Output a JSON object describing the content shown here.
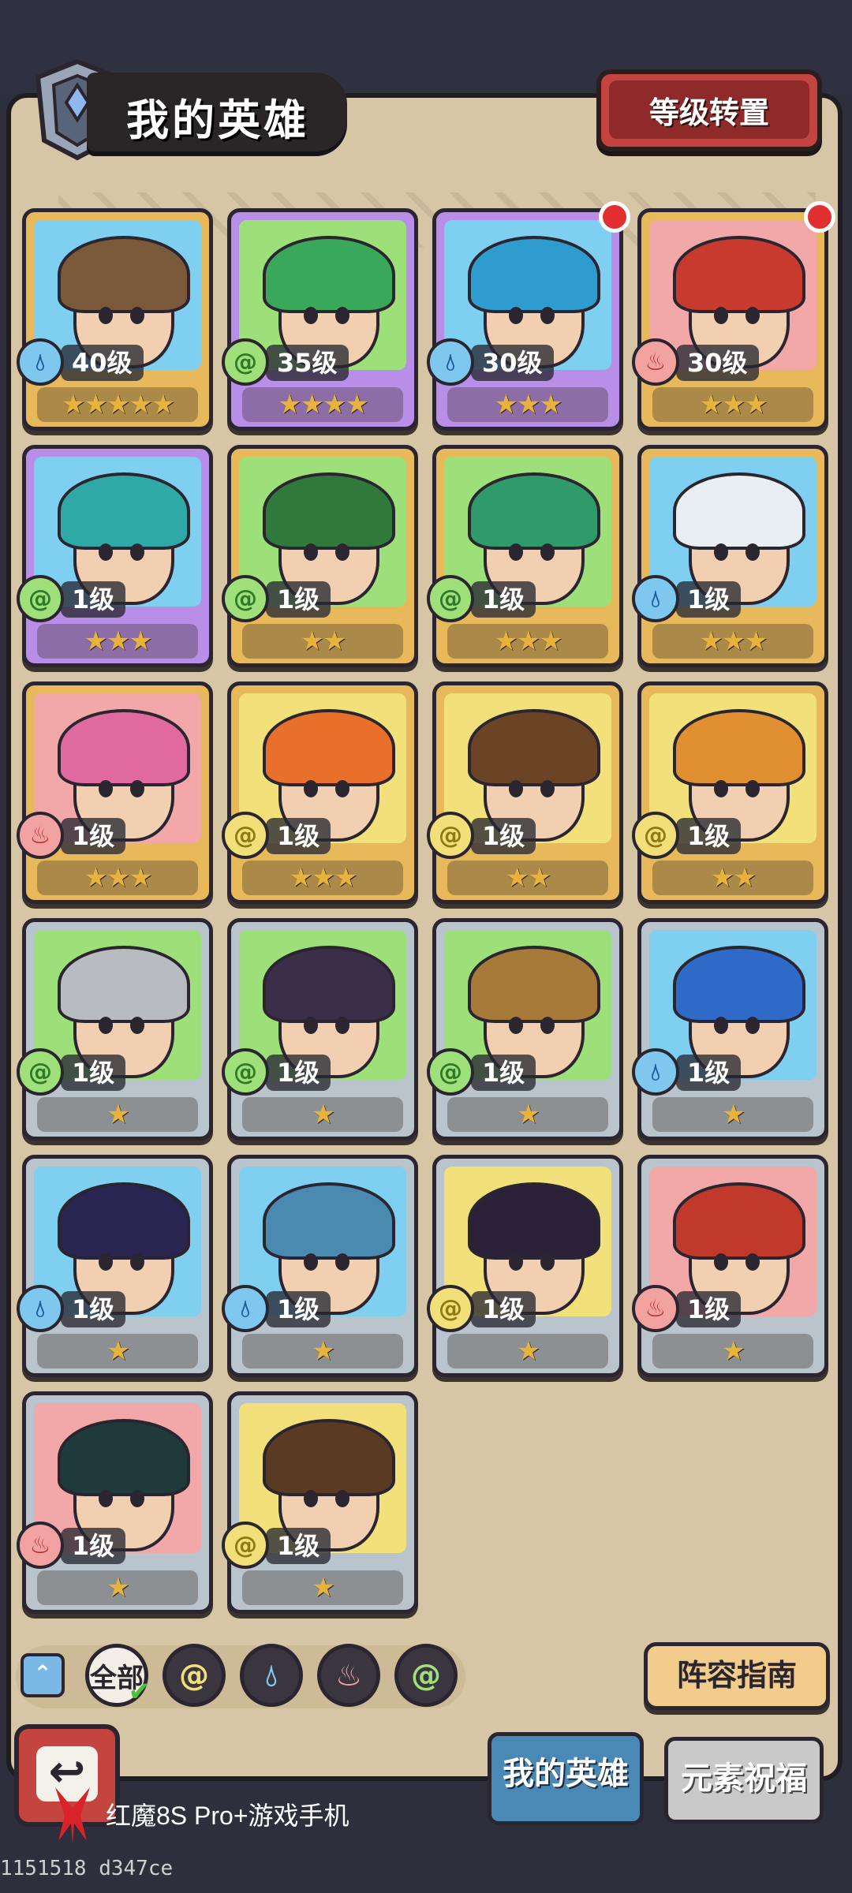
{
  "header": {
    "title": "我的英雄",
    "level_transfer_button": "等级转置"
  },
  "heroes": [
    {
      "level": "40级",
      "stars": "★★★★★",
      "element": "water",
      "rarity": "gold",
      "bg": "#7fd0f0",
      "hair": "#7a5a3a",
      "new": false
    },
    {
      "level": "35级",
      "stars": "★★★★",
      "element": "wind",
      "rarity": "purple",
      "bg": "#9de07a",
      "hair": "#3aa85a",
      "new": false
    },
    {
      "level": "30级",
      "stars": "★★★",
      "element": "water",
      "rarity": "purple",
      "bg": "#7fd0f0",
      "hair": "#2f9ccf",
      "new": true
    },
    {
      "level": "30级",
      "stars": "★★★",
      "element": "fire",
      "rarity": "gold",
      "bg": "#f2a8a8",
      "hair": "#c93a2e",
      "new": true
    },
    {
      "level": "1级",
      "stars": "★★★",
      "element": "wind",
      "rarity": "purple",
      "bg": "#7fd0f0",
      "hair": "#2fa8a8",
      "new": false
    },
    {
      "level": "1级",
      "stars": "★★",
      "element": "wind",
      "rarity": "gold",
      "bg": "#9de07a",
      "hair": "#2f7a3a",
      "new": false
    },
    {
      "level": "1级",
      "stars": "★★★",
      "element": "wind",
      "rarity": "gold",
      "bg": "#9de07a",
      "hair": "#2f9a6a",
      "new": false
    },
    {
      "level": "1级",
      "stars": "★★★",
      "element": "water",
      "rarity": "gold",
      "bg": "#7fd0f0",
      "hair": "#e8eef2",
      "new": false
    },
    {
      "level": "1级",
      "stars": "★★★",
      "element": "fire",
      "rarity": "gold",
      "bg": "#f2a8a8",
      "hair": "#e06aa0",
      "new": false
    },
    {
      "level": "1级",
      "stars": "★★★",
      "element": "earth",
      "rarity": "gold",
      "bg": "#f2e07a",
      "hair": "#e8702a",
      "new": false
    },
    {
      "level": "1级",
      "stars": "★★",
      "element": "earth",
      "rarity": "gold",
      "bg": "#f2e07a",
      "hair": "#6a4424",
      "new": false
    },
    {
      "level": "1级",
      "stars": "★★",
      "element": "earth",
      "rarity": "gold",
      "bg": "#f2e07a",
      "hair": "#e09030",
      "new": false
    },
    {
      "level": "1级",
      "stars": "★",
      "element": "wind",
      "rarity": "silver",
      "bg": "#9de07a",
      "hair": "#b8bcc0",
      "new": false
    },
    {
      "level": "1级",
      "stars": "★",
      "element": "wind",
      "rarity": "silver",
      "bg": "#9de07a",
      "hair": "#3a2e48",
      "new": false
    },
    {
      "level": "1级",
      "stars": "★",
      "element": "wind",
      "rarity": "silver",
      "bg": "#9de07a",
      "hair": "#a87a3a",
      "new": false
    },
    {
      "level": "1级",
      "stars": "★",
      "element": "water",
      "rarity": "silver",
      "bg": "#7fd0f0",
      "hair": "#2f6ac8",
      "new": false
    },
    {
      "level": "1级",
      "stars": "★",
      "element": "water",
      "rarity": "silver",
      "bg": "#7fd0f0",
      "hair": "#2a2450",
      "new": false
    },
    {
      "level": "1级",
      "stars": "★",
      "element": "water",
      "rarity": "silver",
      "bg": "#7fd0f0",
      "hair": "#4a8ab0",
      "new": false
    },
    {
      "level": "1级",
      "stars": "★",
      "element": "earth",
      "rarity": "silver",
      "bg": "#f2e07a",
      "hair": "#2a2038",
      "new": false
    },
    {
      "level": "1级",
      "stars": "★",
      "element": "fire",
      "rarity": "silver",
      "bg": "#f2a8a8",
      "hair": "#c0392b",
      "new": false
    },
    {
      "level": "1级",
      "stars": "★",
      "element": "fire",
      "rarity": "silver",
      "bg": "#f2a8a8",
      "hair": "#1e3a3a",
      "new": false
    },
    {
      "level": "1级",
      "stars": "★",
      "element": "earth",
      "rarity": "silver",
      "bg": "#f2e07a",
      "hair": "#5a3a22",
      "new": false
    }
  ],
  "element_icons": {
    "water": "water-drop-icon",
    "wind": "wind-swirl-icon",
    "fire": "fire-flame-icon",
    "earth": "earth-swirl-icon"
  },
  "filters": {
    "all_label": "全部",
    "elements": [
      "earth",
      "water",
      "fire",
      "wind"
    ]
  },
  "guide_button": "阵容指南",
  "tabs": {
    "my_heroes": "我的英雄",
    "element_blessing": "元素祝福"
  },
  "watermark": {
    "text": "红魔8S Pro+游戏手机",
    "serial": "1151518 d347ce"
  },
  "colors": {
    "water": "#7ec8f0",
    "wind": "#9fe07a",
    "fire": "#f3a2a2",
    "earth": "#f1e07a",
    "accent_red": "#c4453f",
    "tab_blue": "#4a88b6"
  }
}
